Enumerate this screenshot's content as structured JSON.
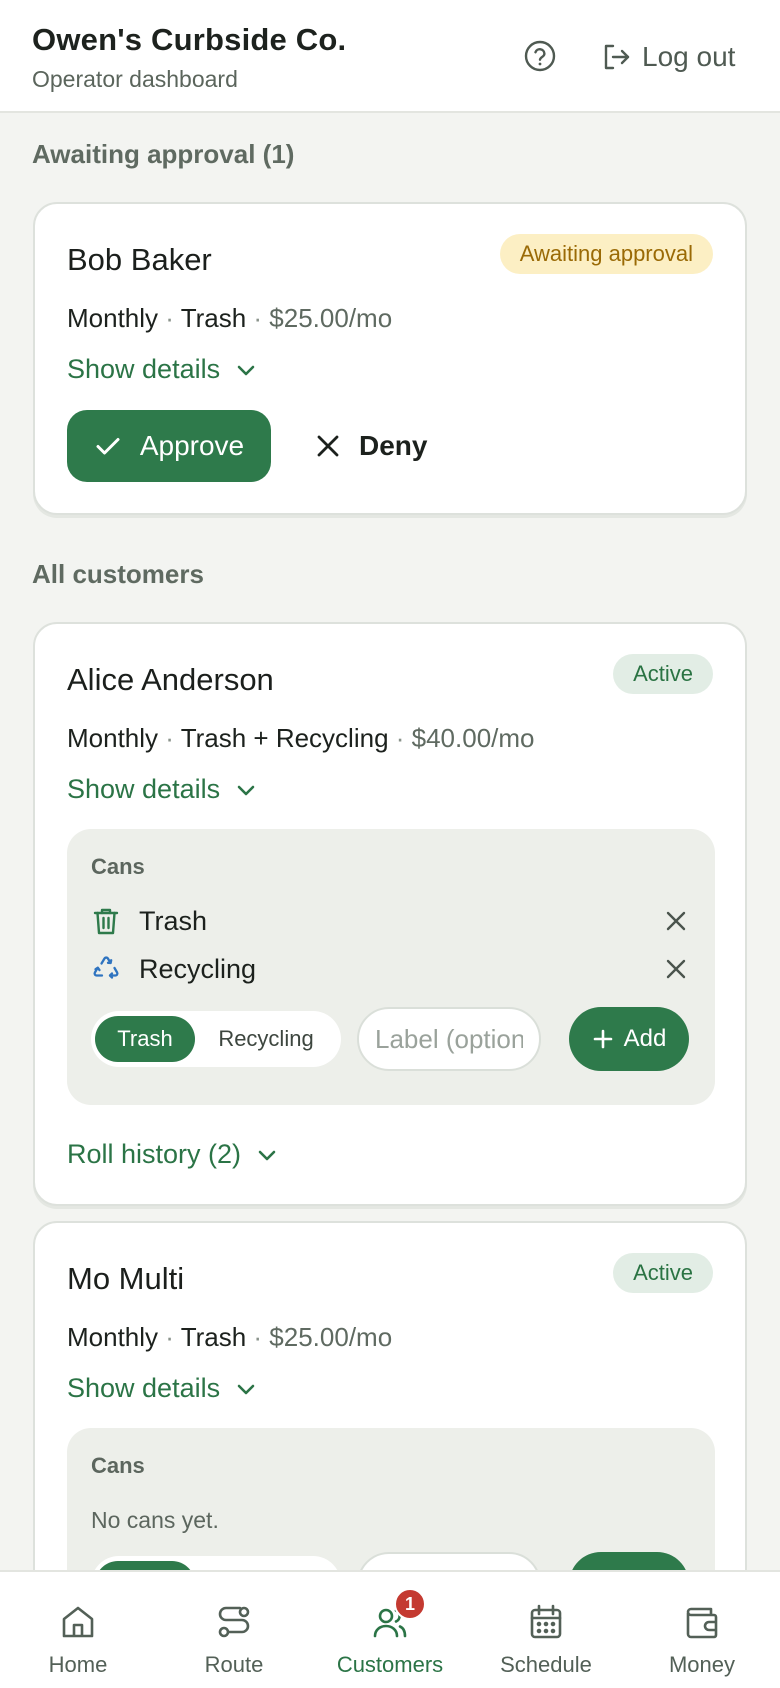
{
  "header": {
    "company": "Owen's Curbside Co.",
    "subtitle": "Operator dashboard",
    "logout_label": "Log out"
  },
  "awaiting": {
    "title": "Awaiting approval (1)",
    "customer": {
      "name": "Bob Baker",
      "status": "Awaiting approval",
      "frequency": "Monthly",
      "service": "Trash",
      "price": "$25.00/mo",
      "show_details": "Show details",
      "approve_label": "Approve",
      "deny_label": "Deny"
    }
  },
  "customers": {
    "title": "All customers",
    "items": [
      {
        "name": "Alice Anderson",
        "status": "Active",
        "frequency": "Monthly",
        "service": "Trash + Recycling",
        "price": "$40.00/mo",
        "show_details": "Show details",
        "cans_title": "Cans",
        "cans": [
          {
            "label": "Trash",
            "icon": "trash-can-icon"
          },
          {
            "label": "Recycling",
            "icon": "recycle-icon"
          }
        ],
        "type_options": [
          "Trash",
          "Recycling"
        ],
        "selected_type": "Trash",
        "label_placeholder": "Label (optional)",
        "add_label": "Add",
        "roll_history": "Roll history (2)"
      },
      {
        "name": "Mo Multi",
        "status": "Active",
        "frequency": "Monthly",
        "service": "Trash",
        "price": "$25.00/mo",
        "show_details": "Show details",
        "cans_title": "Cans",
        "no_cans": "No cans yet."
      }
    ]
  },
  "nav": {
    "items": [
      {
        "label": "Home",
        "icon": "home-icon"
      },
      {
        "label": "Route",
        "icon": "route-icon"
      },
      {
        "label": "Customers",
        "icon": "users-icon",
        "badge": "1"
      },
      {
        "label": "Schedule",
        "icon": "calendar-icon"
      },
      {
        "label": "Money",
        "icon": "wallet-icon"
      }
    ],
    "active": "Customers"
  },
  "colors": {
    "primary": "#2e7a4b",
    "awaiting_bg": "#fcefc4",
    "awaiting_text": "#9a6a06",
    "active_bg": "#e2ede5",
    "badge_red": "#c43a31"
  }
}
